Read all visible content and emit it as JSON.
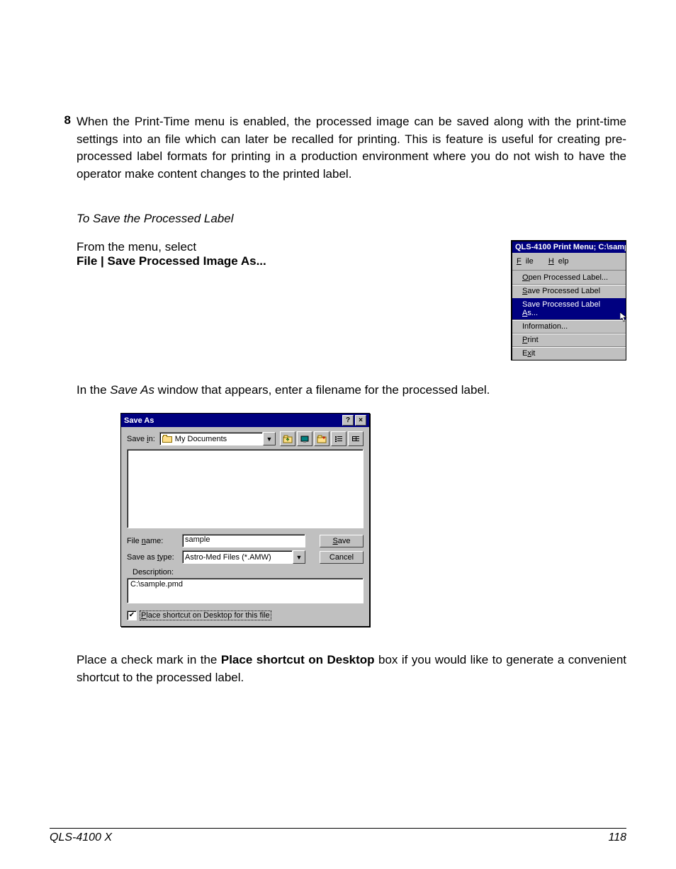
{
  "step": {
    "number": "8",
    "text": "When the Print-Time menu is enabled, the processed image can be saved along with the print-time settings into an file which can later be recalled for printing.  This is feature is useful for creating pre-processed label formats for printing in a production environment where you do not wish to have the operator make content changes to the printed label."
  },
  "subhead": "To Save the Processed Label",
  "instruction": {
    "line1": "From the menu, select",
    "line2": "File | Save Processed Image As..."
  },
  "menu_window": {
    "title": "QLS-4100 Print Menu;  C:\\samp",
    "menubar": {
      "file": "File",
      "help": "Help"
    },
    "items": {
      "open": "Open Processed Label...",
      "save": "Save Processed Label",
      "saveas": "Save Processed Label As...",
      "info": "Information...",
      "print": "Print",
      "exit": "Exit"
    }
  },
  "para2_a": "In the ",
  "para2_b": "Save As",
  "para2_c": " window that appears, enter a filename for the processed label.",
  "saveas": {
    "title": "Save As",
    "savein_label": "Save in:",
    "savein_value": "My Documents",
    "filename_label": "File name:",
    "filename_value": "sample",
    "savetype_label": "Save as type:",
    "savetype_value": "Astro-Med Files (*.AMW)",
    "desc_label": "Description:",
    "desc_value": "C:\\sample.pmd",
    "chk_label": "Place shortcut on Desktop for this file",
    "save_btn": "Save",
    "cancel_btn": "Cancel"
  },
  "para3_a": "Place a check mark in the ",
  "para3_b": "Place shortcut on Desktop",
  "para3_c": " box if you would like to generate a convenient shortcut to the processed label.",
  "footer": {
    "left": "QLS-4100 X",
    "right": "118"
  }
}
